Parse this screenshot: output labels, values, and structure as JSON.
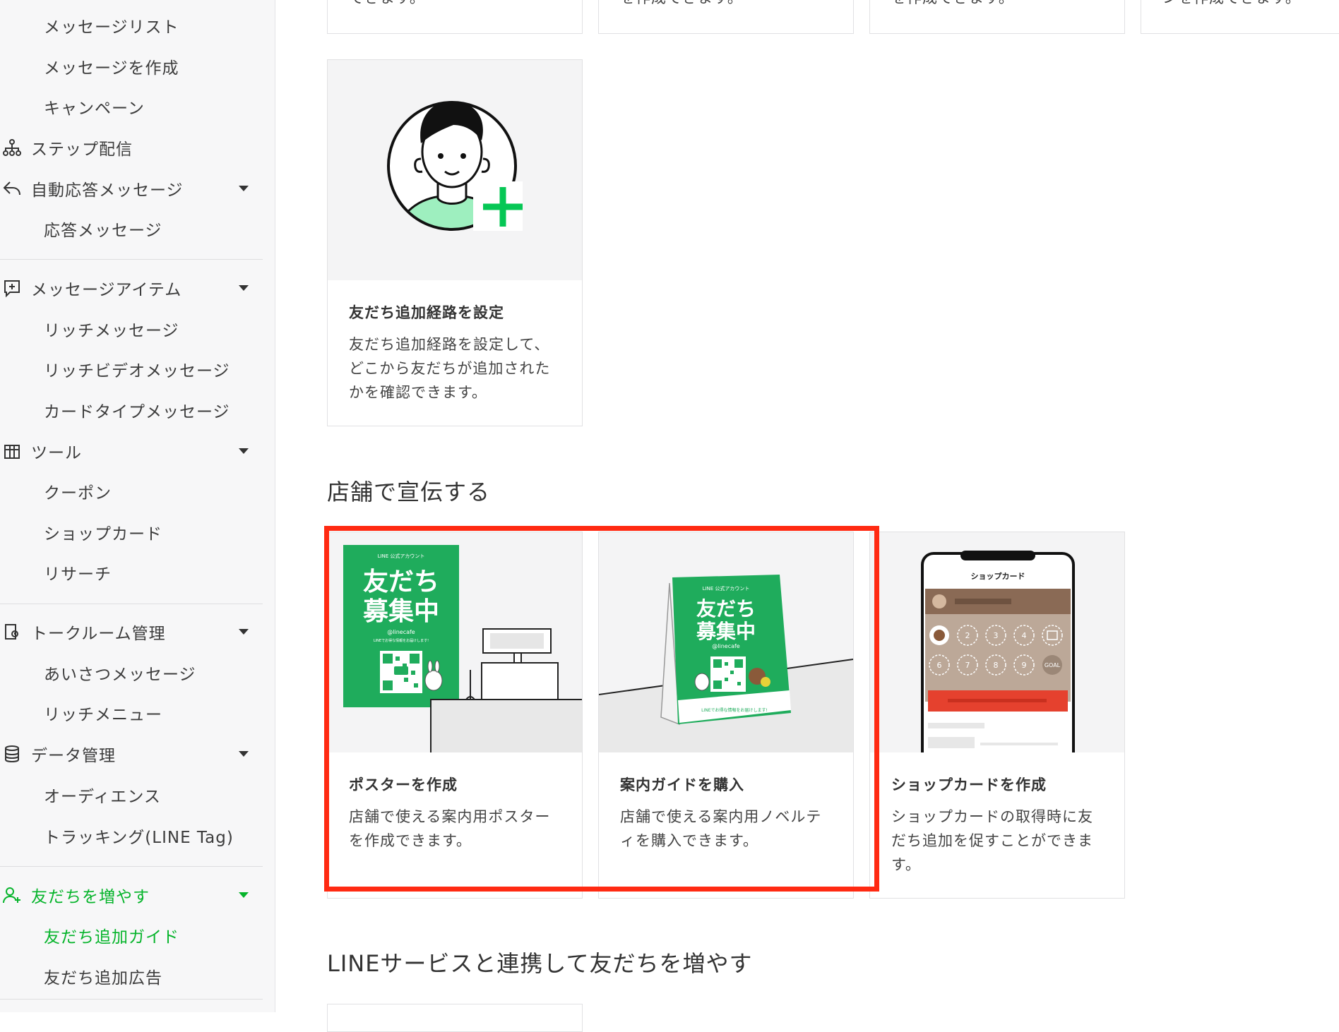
{
  "sidebar": {
    "items": [
      {
        "label": "メッセージリスト",
        "level": "sub"
      },
      {
        "label": "メッセージを作成",
        "level": "sub"
      },
      {
        "label": "キャンペーン",
        "level": "sub"
      },
      {
        "label": "ステップ配信",
        "level": "top",
        "icon": "step-delivery-icon"
      },
      {
        "label": "自動応答メッセージ",
        "level": "top",
        "icon": "reply-arrow-icon",
        "expandable": true
      },
      {
        "label": "応答メッセージ",
        "level": "sub"
      },
      {
        "label": "メッセージアイテム",
        "level": "top",
        "icon": "message-plus-icon",
        "expandable": true
      },
      {
        "label": "リッチメッセージ",
        "level": "sub"
      },
      {
        "label": "リッチビデオメッセージ",
        "level": "sub"
      },
      {
        "label": "カードタイプメッセージ",
        "level": "sub"
      },
      {
        "label": "ツール",
        "level": "top",
        "icon": "tool-box-icon",
        "expandable": true
      },
      {
        "label": "クーポン",
        "level": "sub"
      },
      {
        "label": "ショップカード",
        "level": "sub"
      },
      {
        "label": "リサーチ",
        "level": "sub"
      },
      {
        "label": "トークルーム管理",
        "level": "top",
        "icon": "talk-room-icon",
        "expandable": true
      },
      {
        "label": "あいさつメッセージ",
        "level": "sub"
      },
      {
        "label": "リッチメニュー",
        "level": "sub"
      },
      {
        "label": "データ管理",
        "level": "top",
        "icon": "database-icon",
        "expandable": true
      },
      {
        "label": "オーディエンス",
        "level": "sub"
      },
      {
        "label": "トラッキング(LINE Tag)",
        "level": "sub"
      },
      {
        "label": "友だちを増やす",
        "level": "top",
        "icon": "add-friend-icon",
        "expandable": true,
        "active": true
      },
      {
        "label": "友だち追加ガイド",
        "level": "sub",
        "active": true
      },
      {
        "label": "友だち追加広告",
        "level": "sub"
      }
    ]
  },
  "top_cards_cut": [
    "できます。",
    "を作成できます。",
    "を作成できます。",
    "ンを作成できます。"
  ],
  "friend_route_card": {
    "title": "友だち追加経路を設定",
    "description": "友だち追加経路を設定して、どこから友だちが追加されたかを確認できます。"
  },
  "store_section": {
    "heading": "店舗で宣伝する",
    "cards": [
      {
        "title": "ポスターを作成",
        "description": "店舗で使える案内用ポスターを作成できます。"
      },
      {
        "title": "案内ガイドを購入",
        "description": "店舗で使える案内用ノベルティを購入できます。"
      },
      {
        "title": "ショップカードを作成",
        "description": "ショップカードの取得時に友だち追加を促すことができます。"
      }
    ]
  },
  "poster_art": {
    "account": "LINE 公式アカウント",
    "headline_1": "友だち",
    "headline_2": "募集中",
    "handle": "@linecafe",
    "note": "LINEでお得な情報をお届けします!"
  },
  "guide_art": {
    "account": "LINE 公式アカウント",
    "headline_1": "友だち",
    "headline_2": "募集中",
    "handle": "@linecafe",
    "note": "LINEでお得な情報をお届けします!"
  },
  "shopcard_art": {
    "title": "ショップカード",
    "stamps": [
      "2",
      "3",
      "4",
      "6",
      "7",
      "8",
      "9",
      "GOAL"
    ]
  },
  "line_section": {
    "heading": "LINEサービスと連携して友だちを増やす"
  },
  "colors": {
    "brand_green": "#06c755",
    "active_green": "#06b42b",
    "highlight_red": "#ff2a12",
    "poster_green": "#1fac5c"
  }
}
